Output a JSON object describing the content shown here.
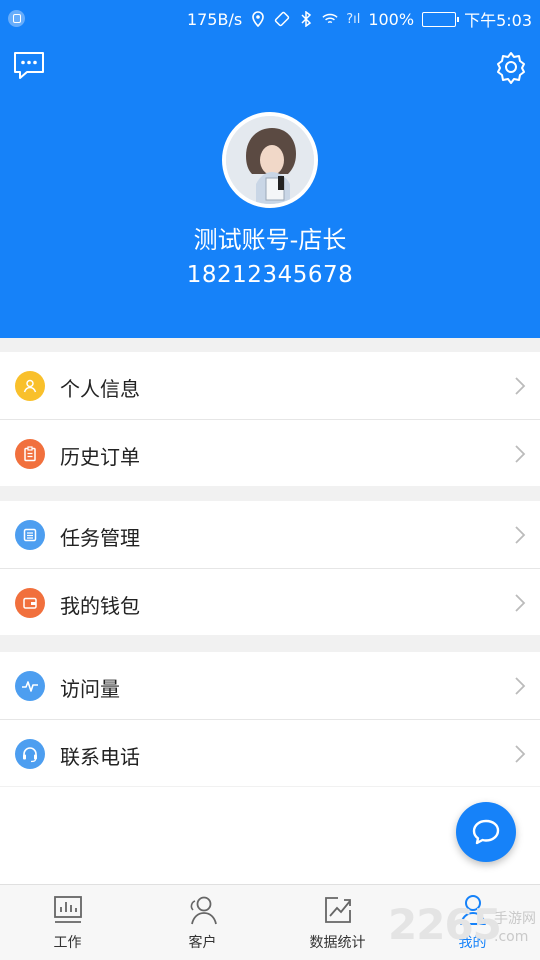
{
  "status_bar": {
    "network_speed": "175B/s",
    "signal": "?ıl",
    "battery": "100%",
    "battery_level": 1.0,
    "time": "下午5:03"
  },
  "header": {
    "username": "测试账号-店长",
    "phone": "18212345678"
  },
  "menu_groups": [
    [
      {
        "label": "个人信息",
        "icon": "person-icon",
        "color": "#f9c02b"
      },
      {
        "label": "历史订单",
        "icon": "clipboard-icon",
        "color": "#f1703d"
      }
    ],
    [
      {
        "label": "任务管理",
        "icon": "list-icon",
        "color": "#4d9ef0"
      },
      {
        "label": "我的钱包",
        "icon": "wallet-icon",
        "color": "#f1703d"
      }
    ],
    [
      {
        "label": "访问量",
        "icon": "pulse-icon",
        "color": "#4d9ef0"
      },
      {
        "label": "联系电话",
        "icon": "headset-icon",
        "color": "#4d9ef0"
      }
    ]
  ],
  "tabs": [
    {
      "label": "工作",
      "icon": "chart-board-icon"
    },
    {
      "label": "客户",
      "icon": "customers-icon"
    },
    {
      "label": "数据统计",
      "icon": "trend-icon"
    },
    {
      "label": "我的",
      "icon": "profile-icon",
      "active": true
    }
  ],
  "watermark": {
    "number": "2265",
    "line1": "手游网",
    "line2": ".com"
  },
  "colors": {
    "primary": "#1682f9",
    "background": "#f1f1f1"
  }
}
